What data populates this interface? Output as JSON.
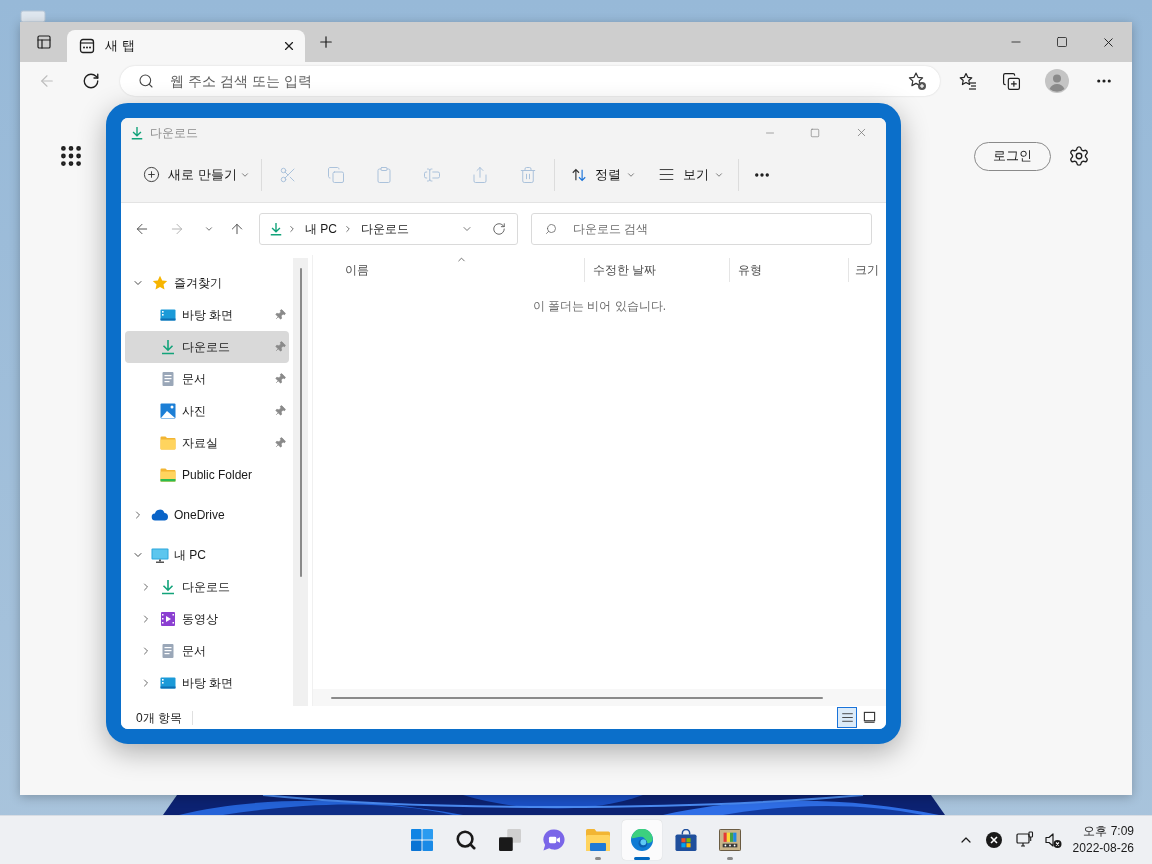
{
  "browser": {
    "tabs": [
      {
        "title": "새 탭",
        "selected": true
      }
    ],
    "back_button": {
      "disabled": true
    },
    "address_bar": {
      "placeholder": "웹 주소 검색 또는 입력"
    },
    "page": {
      "login_button": "로그인"
    }
  },
  "explorer": {
    "title": "다운로드",
    "command_bar": {
      "new_button": "새로 만들기",
      "tools": [
        {
          "kind": "cut",
          "disabled": true
        },
        {
          "kind": "copy",
          "disabled": true
        },
        {
          "kind": "paste",
          "disabled": true
        },
        {
          "kind": "rename",
          "disabled": true
        },
        {
          "kind": "share",
          "disabled": true
        },
        {
          "kind": "delete",
          "disabled": true
        }
      ],
      "sort_button": "정렬",
      "view_button": "보기"
    },
    "nav_buttons": [
      {
        "kind": "back",
        "disabled": false
      },
      {
        "kind": "forward",
        "disabled": true
      },
      {
        "kind": "recent",
        "disabled": false
      },
      {
        "kind": "up",
        "disabled": false
      }
    ],
    "address": {
      "path": [
        "내 PC",
        "다운로드"
      ]
    },
    "search": {
      "placeholder": "다운로드 검색"
    },
    "sidebar": [
      {
        "kind": "favorites",
        "label": "즐겨찾기",
        "expanded": true,
        "selected": false,
        "children": [
          {
            "kind": "desktop",
            "label": "바탕 화면",
            "pinned": true,
            "selected": false
          },
          {
            "kind": "download",
            "label": "다운로드",
            "pinned": true,
            "selected": true
          },
          {
            "kind": "documents",
            "label": "문서",
            "pinned": true,
            "selected": false
          },
          {
            "kind": "pictures",
            "label": "사진",
            "pinned": true,
            "selected": false
          },
          {
            "kind": "folder",
            "label": "자료실",
            "pinned": true,
            "selected": false
          },
          {
            "kind": "public-folder",
            "label": "Public Folder",
            "pinned": false,
            "selected": false
          }
        ]
      },
      {
        "kind": "cloud",
        "label": "OneDrive",
        "expanded": false,
        "selected": false
      },
      {
        "kind": "pc",
        "label": "내 PC",
        "expanded": true,
        "selected": false,
        "children": [
          {
            "kind": "download",
            "label": "다운로드",
            "expanded": false,
            "selected": false
          },
          {
            "kind": "videos",
            "label": "동영상",
            "expanded": false,
            "selected": false
          },
          {
            "kind": "documents",
            "label": "문서",
            "expanded": false,
            "selected": false
          },
          {
            "kind": "desktop",
            "label": "바탕 화면",
            "expanded": false,
            "selected": false
          }
        ]
      }
    ],
    "columns": [
      {
        "label": "이름",
        "sorted": true
      },
      {
        "label": "수정한 날짜",
        "sorted": false
      },
      {
        "label": "유형",
        "sorted": false
      },
      {
        "label": "크기",
        "sorted": false
      }
    ],
    "empty_message": "이 폴더는 비어 있습니다.",
    "status_bar": {
      "item_count": "0개 항목",
      "views": [
        {
          "kind": "details",
          "selected": true
        },
        {
          "kind": "tiles",
          "selected": false
        }
      ]
    }
  },
  "taskbar": {
    "apps": [
      {
        "kind": "start",
        "running": false,
        "selected": false
      },
      {
        "kind": "search",
        "running": false,
        "selected": false
      },
      {
        "kind": "task-view",
        "running": false,
        "selected": false
      },
      {
        "kind": "chat",
        "running": false,
        "selected": false
      },
      {
        "kind": "file-explorer",
        "running": true,
        "selected": false
      },
      {
        "kind": "edge",
        "running": true,
        "selected": true
      },
      {
        "kind": "store",
        "running": false,
        "selected": false
      },
      {
        "kind": "app",
        "running": true,
        "selected": false
      }
    ],
    "tray": [
      {
        "kind": "chevron"
      },
      {
        "kind": "error"
      },
      {
        "kind": "network"
      },
      {
        "kind": "volume-muted"
      }
    ],
    "clock": {
      "time": "오후 7:09",
      "date": "2022-08-26"
    }
  }
}
